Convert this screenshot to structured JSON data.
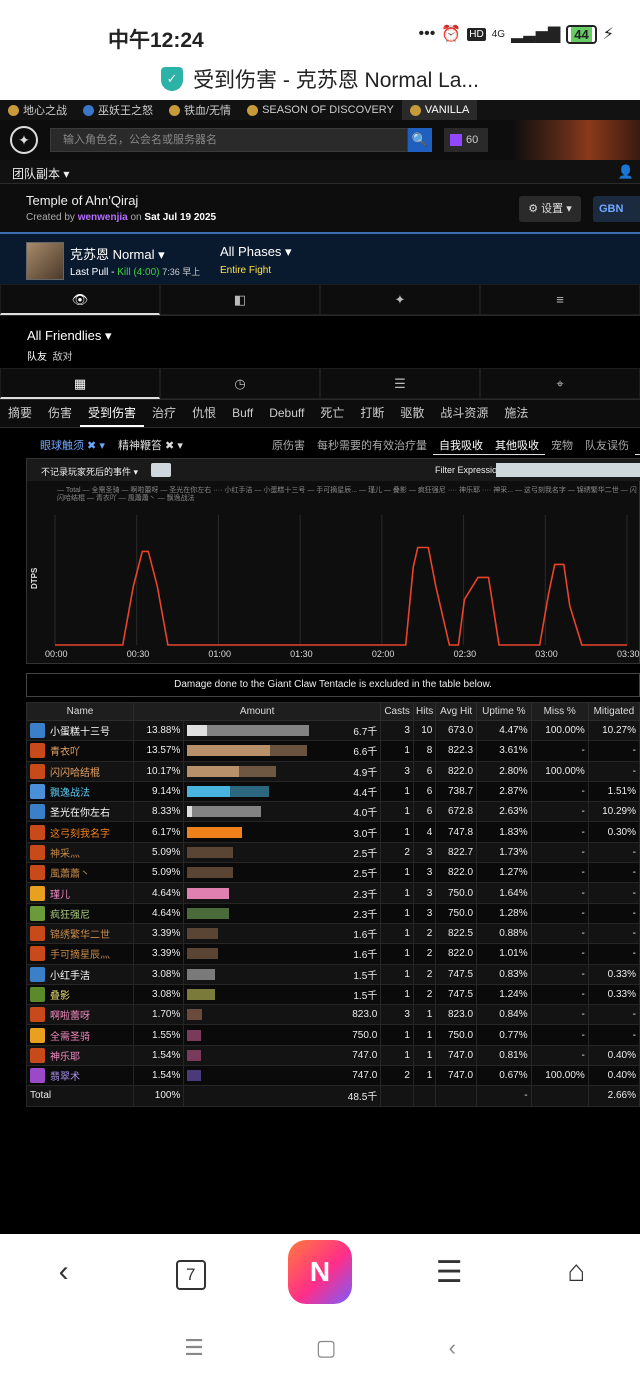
{
  "status": {
    "time": "中午12:24",
    "signal": "4G",
    "hd": "HD",
    "battery": "44"
  },
  "browser_title": "受到伤害 - 克苏恩 Normal La...",
  "game_tabs": [
    {
      "label": "地心之战",
      "active": false
    },
    {
      "label": "巫妖王之怒",
      "active": false
    },
    {
      "label": "铁血/无情",
      "active": false
    },
    {
      "label": "SEASON OF DISCOVERY",
      "active": false
    },
    {
      "label": "VANILLA",
      "active": true
    }
  ],
  "header": {
    "search_placeholder": "输入角色名，公会名或服务器名",
    "twitch_count": "60"
  },
  "raid_menu": "团队副本 ▾",
  "report": {
    "name": "Temple of Ahn'Qiraj",
    "created_prefix": "Created by ",
    "author": "wenwenjia",
    "on": " on ",
    "date": "Sat Jul 19 2025",
    "settings_label": "⚙ 设置 ▾",
    "region": "GBN"
  },
  "fight": {
    "boss": "克苏恩 Normal ▾",
    "last_pull_label": "Last Pull - ",
    "kill": "Kill (4:00)",
    "time": "7:36 早上",
    "phases": "All Phases ▾",
    "phase_value": "Entire Fight"
  },
  "view_tabs": [
    "👁",
    "◧",
    "✦",
    "≡"
  ],
  "filters": {
    "all": "All Friendlies ▾",
    "friend": "队友",
    "enemy": "敌对"
  },
  "mode_tabs": [
    "▦",
    "◷",
    "☰",
    "⌖"
  ],
  "text_tabs": [
    {
      "label": "摘要",
      "active": false
    },
    {
      "label": "伤害",
      "active": false
    },
    {
      "label": "受到伤害",
      "active": true
    },
    {
      "label": "治疗",
      "active": false
    },
    {
      "label": "仇恨",
      "active": false
    },
    {
      "label": "Buff",
      "active": false
    },
    {
      "label": "Debuff",
      "active": false
    },
    {
      "label": "死亡",
      "active": false
    },
    {
      "label": "打断",
      "active": false
    },
    {
      "label": "驱散",
      "active": false
    },
    {
      "label": "战斗资源",
      "active": false
    },
    {
      "label": "施法",
      "active": false
    }
  ],
  "ability_filters": {
    "a1": "眼球触须 ✖ ▾",
    "a2": "精神鞭笞 ✖ ▾",
    "options": [
      {
        "label": "原伤害",
        "on": false
      },
      {
        "label": "每秒需要的有效治疗量",
        "on": false
      },
      {
        "label": "自我吸收",
        "on": true
      },
      {
        "label": "其他吸收",
        "on": true
      },
      {
        "label": "宠物",
        "on": false
      },
      {
        "label": "队友误伤",
        "on": false
      },
      {
        "label": "Take",
        "on": true
      }
    ]
  },
  "graph": {
    "checkbox_label": "不记录玩家死后的事件 ▾",
    "filter_label": "Filter Expression:",
    "legend": "— Total  — 全需圣骑  — 啊啦蕾呀  — 圣光在你左右  ···· 小红手洁  — 小蛋糕十三号  — 手可摘星辰...  — 瑾儿  — 叠影  — 疯狂强尼  ···· 神乐耶  ···· 神采...  — 这弓刻我名字  — 锦绣繁华二世  — 闪闪哈结棍  — 青衣吖  — 風蕭蕭丶  — 飘逸战法"
  },
  "chart_data": {
    "type": "line",
    "ylabel": "DTPS",
    "x_ticks": [
      "00:00",
      "00:30",
      "01:00",
      "01:30",
      "02:00",
      "02:30",
      "03:00",
      "03:30"
    ],
    "ylim": [
      0,
      1
    ],
    "x_seconds": [
      0,
      50,
      62,
      78,
      90,
      120,
      125,
      150,
      165,
      172,
      180,
      185,
      200,
      225,
      232,
      240,
      245,
      260,
      275,
      282,
      290,
      296,
      330
    ],
    "series": [
      {
        "name": "Total",
        "values": [
          0,
          0,
          0.72,
          0.72,
          0,
          0,
          0,
          0,
          0,
          0,
          0,
          0,
          0,
          0,
          0,
          0,
          0,
          0,
          0,
          0,
          0,
          0,
          0
        ]
      }
    ],
    "series_full": {
      "name": "Total",
      "x": [
        0,
        45,
        52,
        58,
        62,
        68,
        75,
        210,
        233,
        238,
        241,
        248,
        253,
        262,
        268,
        272,
        281,
        288,
        295,
        322,
        328,
        332,
        338,
        342,
        350,
        380
      ],
      "y": [
        0,
        0,
        0.45,
        0.72,
        0.72,
        0.45,
        0,
        0,
        0,
        0.6,
        0.75,
        0.75,
        0.45,
        0,
        0,
        0.35,
        0.52,
        0.52,
        0,
        0,
        0.4,
        0.62,
        0.62,
        0.3,
        0,
        0
      ]
    }
  },
  "note": "Damage done to the Giant Claw Tentacle is excluded in the table below.",
  "table": {
    "headers": [
      "Name",
      "Amount",
      "",
      "Casts",
      "Hits",
      "Avg Hit",
      "Uptime %",
      "Miss %",
      "Mitigated"
    ],
    "rows": [
      {
        "name": "小蛋糕十三号",
        "color": "#ffffff",
        "icon": "#3a7fc7",
        "pct": "13.88%",
        "amount": "6.7千",
        "frac": 0.16,
        "rest": 0.84,
        "bar": "#e0e0e0",
        "casts": "3",
        "hits": "10",
        "avg": "673.0",
        "uptime": "4.47%",
        "miss": "100.00%",
        "mit": "10.27%"
      },
      {
        "name": "青衣吖",
        "color": "#e8a262",
        "icon": "#c84a1a",
        "pct": "13.57%",
        "amount": "6.6千",
        "frac": 0.68,
        "rest": 0.3,
        "bar": "#b8906a",
        "casts": "1",
        "hits": "8",
        "avg": "822.3",
        "uptime": "3.61%",
        "miss": "-",
        "mit": "-"
      },
      {
        "name": "闪闪哈结棍",
        "color": "#e8a262",
        "icon": "#c84a1a",
        "pct": "10.17%",
        "amount": "4.9千",
        "frac": 0.42,
        "rest": 0.31,
        "bar": "#b8906a",
        "casts": "3",
        "hits": "6",
        "avg": "822.0",
        "uptime": "2.80%",
        "miss": "100.00%",
        "mit": "-"
      },
      {
        "name": "飘逸战法",
        "color": "#5ac8f0",
        "icon": "#4a90d9",
        "pct": "9.14%",
        "amount": "4.4千",
        "frac": 0.35,
        "rest": 0.32,
        "bar": "#4ab4e0",
        "casts": "1",
        "hits": "6",
        "avg": "738.7",
        "uptime": "2.87%",
        "miss": "-",
        "mit": "1.51%"
      },
      {
        "name": "圣光在你左右",
        "color": "#ffffff",
        "icon": "#3a7fc7",
        "pct": "8.33%",
        "amount": "4.0千",
        "frac": 0.04,
        "rest": 0.56,
        "bar": "#e0e0e0",
        "casts": "1",
        "hits": "6",
        "avg": "672.8",
        "uptime": "2.63%",
        "miss": "-",
        "mit": "10.29%"
      },
      {
        "name": "这弓刻我名字",
        "color": "#f0801a",
        "icon": "#c84a1a",
        "pct": "6.17%",
        "amount": "3.0千",
        "frac": 0.45,
        "rest": 0,
        "bar": "#f0801a",
        "casts": "1",
        "hits": "4",
        "avg": "747.8",
        "uptime": "1.83%",
        "miss": "-",
        "mit": "0.30%"
      },
      {
        "name": "神采灬",
        "color": "#c88a4a",
        "icon": "#c84a1a",
        "pct": "5.09%",
        "amount": "2.5千",
        "frac": 0.37,
        "rest": 0,
        "bar": "#5a4434",
        "casts": "2",
        "hits": "3",
        "avg": "822.7",
        "uptime": "1.73%",
        "miss": "-",
        "mit": "-"
      },
      {
        "name": "風蕭蕭丶",
        "color": "#c88a4a",
        "icon": "#c84a1a",
        "pct": "5.09%",
        "amount": "2.5千",
        "frac": 0.37,
        "rest": 0,
        "bar": "#5a4434",
        "casts": "1",
        "hits": "3",
        "avg": "822.0",
        "uptime": "1.27%",
        "miss": "-",
        "mit": "-"
      },
      {
        "name": "瑾儿",
        "color": "#f08ac0",
        "icon": "#e8a020",
        "pct": "4.64%",
        "amount": "2.3千",
        "frac": 0.34,
        "rest": 0,
        "bar": "#e080b0",
        "casts": "1",
        "hits": "3",
        "avg": "750.0",
        "uptime": "1.64%",
        "miss": "-",
        "mit": "-"
      },
      {
        "name": "疯狂强尼",
        "color": "#a8c87a",
        "icon": "#6a9a3a",
        "pct": "4.64%",
        "amount": "2.3千",
        "frac": 0.34,
        "rest": 0,
        "bar": "#4a6a3a",
        "casts": "1",
        "hits": "3",
        "avg": "750.0",
        "uptime": "1.28%",
        "miss": "-",
        "mit": "-"
      },
      {
        "name": "锦绣繁华二世",
        "color": "#c88a4a",
        "icon": "#c84a1a",
        "pct": "3.39%",
        "amount": "1.6千",
        "frac": 0.25,
        "rest": 0,
        "bar": "#5a4434",
        "casts": "1",
        "hits": "2",
        "avg": "822.5",
        "uptime": "0.88%",
        "miss": "-",
        "mit": "-"
      },
      {
        "name": "手可摘星辰灬",
        "color": "#c88a4a",
        "icon": "#c84a1a",
        "pct": "3.39%",
        "amount": "1.6千",
        "frac": 0.25,
        "rest": 0,
        "bar": "#5a4434",
        "casts": "1",
        "hits": "2",
        "avg": "822.0",
        "uptime": "1.01%",
        "miss": "-",
        "mit": "-"
      },
      {
        "name": "小红手洁",
        "color": "#ffffff",
        "icon": "#3a7fc7",
        "pct": "3.08%",
        "amount": "1.5千",
        "frac": 0.23,
        "rest": 0,
        "bar": "#7a7a7a",
        "casts": "1",
        "hits": "2",
        "avg": "747.5",
        "uptime": "0.83%",
        "miss": "-",
        "mit": "0.33%"
      },
      {
        "name": "叠影",
        "color": "#e8e070",
        "icon": "#5a8a2a",
        "pct": "3.08%",
        "amount": "1.5千",
        "frac": 0.23,
        "rest": 0,
        "bar": "#7a7a3a",
        "casts": "1",
        "hits": "2",
        "avg": "747.5",
        "uptime": "1.24%",
        "miss": "-",
        "mit": "0.33%"
      },
      {
        "name": "啊啦蕾呀",
        "color": "#f08ac0",
        "icon": "#c84a1a",
        "pct": "1.70%",
        "amount": "823.0",
        "frac": 0.12,
        "rest": 0,
        "bar": "#6a4a3a",
        "casts": "3",
        "hits": "1",
        "avg": "823.0",
        "uptime": "0.84%",
        "miss": "-",
        "mit": "-"
      },
      {
        "name": "全需圣骑",
        "color": "#f08ac0",
        "icon": "#e8a020",
        "pct": "1.55%",
        "amount": "750.0",
        "frac": 0.11,
        "rest": 0,
        "bar": "#7a3a5a",
        "casts": "1",
        "hits": "1",
        "avg": "750.0",
        "uptime": "0.77%",
        "miss": "-",
        "mit": "-"
      },
      {
        "name": "神乐耶",
        "color": "#f08ac0",
        "icon": "#c84a1a",
        "pct": "1.54%",
        "amount": "747.0",
        "frac": 0.11,
        "rest": 0,
        "bar": "#7a3a5a",
        "casts": "1",
        "hits": "1",
        "avg": "747.0",
        "uptime": "0.81%",
        "miss": "-",
        "mit": "0.40%"
      },
      {
        "name": "翡翠术",
        "color": "#a890e8",
        "icon": "#9a4ac8",
        "pct": "1.54%",
        "amount": "747.0",
        "frac": 0.11,
        "rest": 0,
        "bar": "#4a3a7a",
        "casts": "2",
        "hits": "1",
        "avg": "747.0",
        "uptime": "0.67%",
        "miss": "100.00%",
        "mit": "0.40%"
      }
    ],
    "total": {
      "name": "Total",
      "pct": "100%",
      "amount": "48.5千",
      "miss": "-",
      "mit": "2.66%"
    }
  },
  "bottom_nav": {
    "tabs_count": "7",
    "app_letter": "N"
  }
}
